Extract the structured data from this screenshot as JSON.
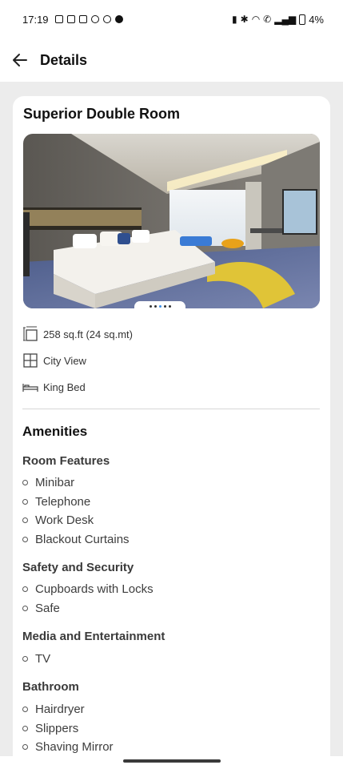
{
  "status_bar": {
    "time": "17:19",
    "battery": "4%"
  },
  "header": {
    "title": "Details"
  },
  "room": {
    "title": "Superior Double Room",
    "image_dots": {
      "count": 5,
      "active": 2
    },
    "features": [
      {
        "icon": "area-icon",
        "text": "258 sq.ft (24 sq.mt)"
      },
      {
        "icon": "window-icon",
        "text": "City View"
      },
      {
        "icon": "bed-icon",
        "text": "King Bed"
      }
    ]
  },
  "amenities": {
    "title": "Amenities",
    "sections": [
      {
        "name": "Room Features",
        "items": [
          "Minibar",
          "Telephone",
          "Work Desk",
          "Blackout Curtains"
        ]
      },
      {
        "name": "Safety and Security",
        "items": [
          "Cupboards with Locks",
          "Safe"
        ]
      },
      {
        "name": "Media and Entertainment",
        "items": [
          "TV"
        ]
      },
      {
        "name": "Bathroom",
        "items": [
          "Hairdryer",
          "Slippers",
          "Shaving Mirror"
        ]
      }
    ]
  }
}
